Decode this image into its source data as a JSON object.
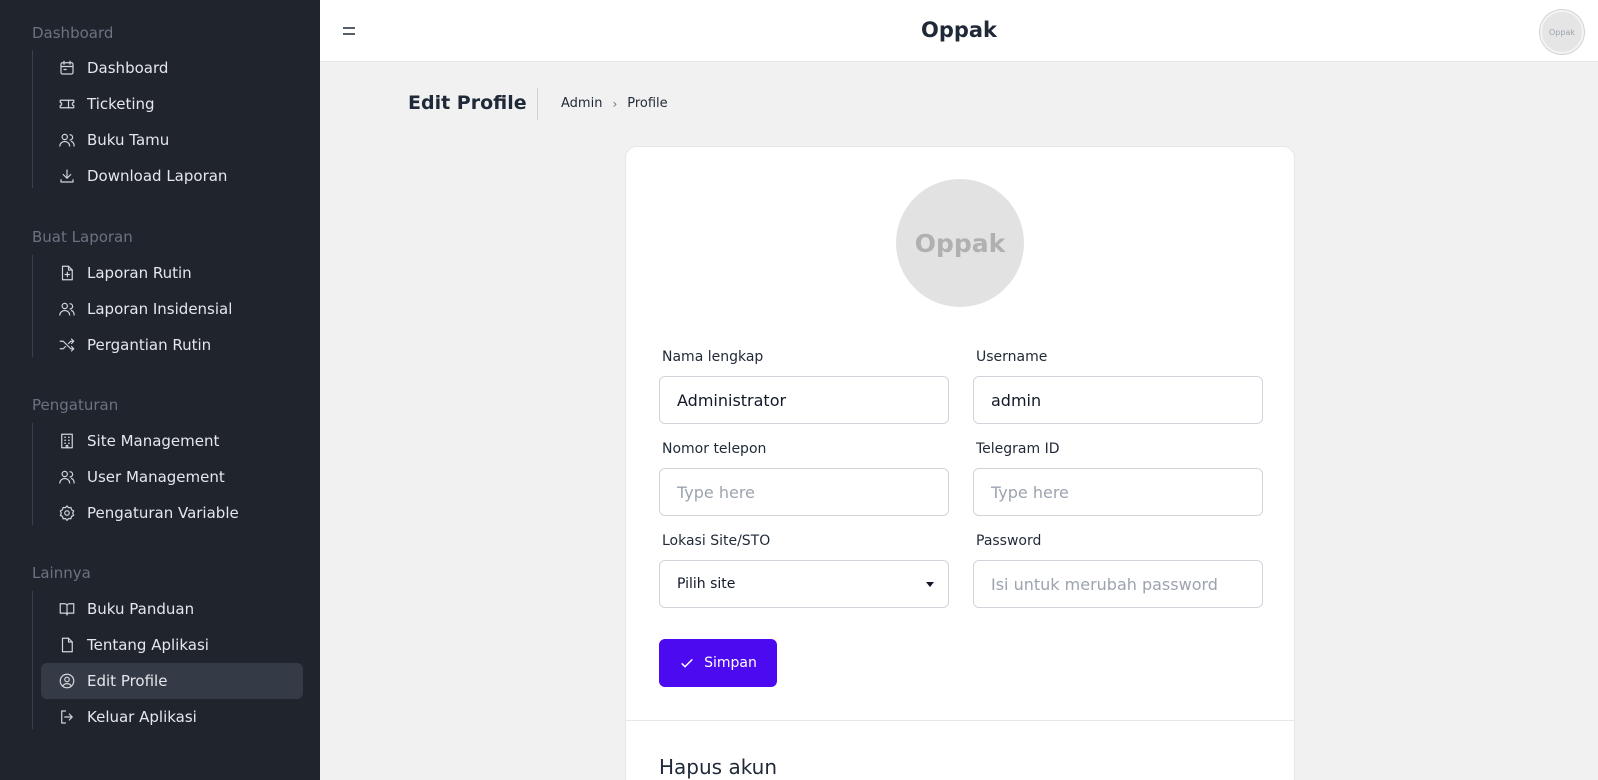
{
  "sidebar": {
    "sections": [
      {
        "title": "Dashboard",
        "items": [
          {
            "label": "Dashboard",
            "icon": "calendar-icon"
          },
          {
            "label": "Ticketing",
            "icon": "ticket-icon"
          },
          {
            "label": "Buku Tamu",
            "icon": "users-icon"
          },
          {
            "label": "Download Laporan",
            "icon": "download-icon"
          }
        ]
      },
      {
        "title": "Buat Laporan",
        "items": [
          {
            "label": "Laporan Rutin",
            "icon": "file-plus-icon"
          },
          {
            "label": "Laporan Insidensial",
            "icon": "users-icon"
          },
          {
            "label": "Pergantian Rutin",
            "icon": "shuffle-icon"
          }
        ]
      },
      {
        "title": "Pengaturan",
        "items": [
          {
            "label": "Site Management",
            "icon": "building-icon"
          },
          {
            "label": "User Management",
            "icon": "users-icon"
          },
          {
            "label": "Pengaturan Variable",
            "icon": "gear-icon"
          }
        ]
      },
      {
        "title": "Lainnya",
        "items": [
          {
            "label": "Buku Panduan",
            "icon": "book-icon"
          },
          {
            "label": "Tentang Aplikasi",
            "icon": "file-icon"
          },
          {
            "label": "Edit Profile",
            "icon": "user-circle-icon",
            "active": true
          },
          {
            "label": "Keluar Aplikasi",
            "icon": "logout-icon"
          }
        ]
      }
    ]
  },
  "topbar": {
    "menu_icon": "hamburger-icon",
    "app_title": "Oppak",
    "avatar_text": "Oppak"
  },
  "header": {
    "title": "Edit Profile",
    "breadcrumb": [
      "Admin",
      "Profile"
    ]
  },
  "form": {
    "avatar_text": "Oppak",
    "nama_label": "Nama lengkap",
    "nama_value": "Administrator",
    "username_label": "Username",
    "username_value": "admin",
    "telepon_label": "Nomor telepon",
    "telepon_placeholder": "Type here",
    "telegram_label": "Telegram ID",
    "telegram_placeholder": "Type here",
    "lokasi_label": "Lokasi Site/STO",
    "lokasi_value": "Pilih site",
    "password_label": "Password",
    "password_placeholder": "Isi untuk merubah password",
    "save_label": "Simpan",
    "delete_heading": "Hapus akun"
  },
  "colors": {
    "sidebar_bg": "#1f242d",
    "accent": "#4c0af0",
    "page_bg": "#f1f1f1"
  }
}
